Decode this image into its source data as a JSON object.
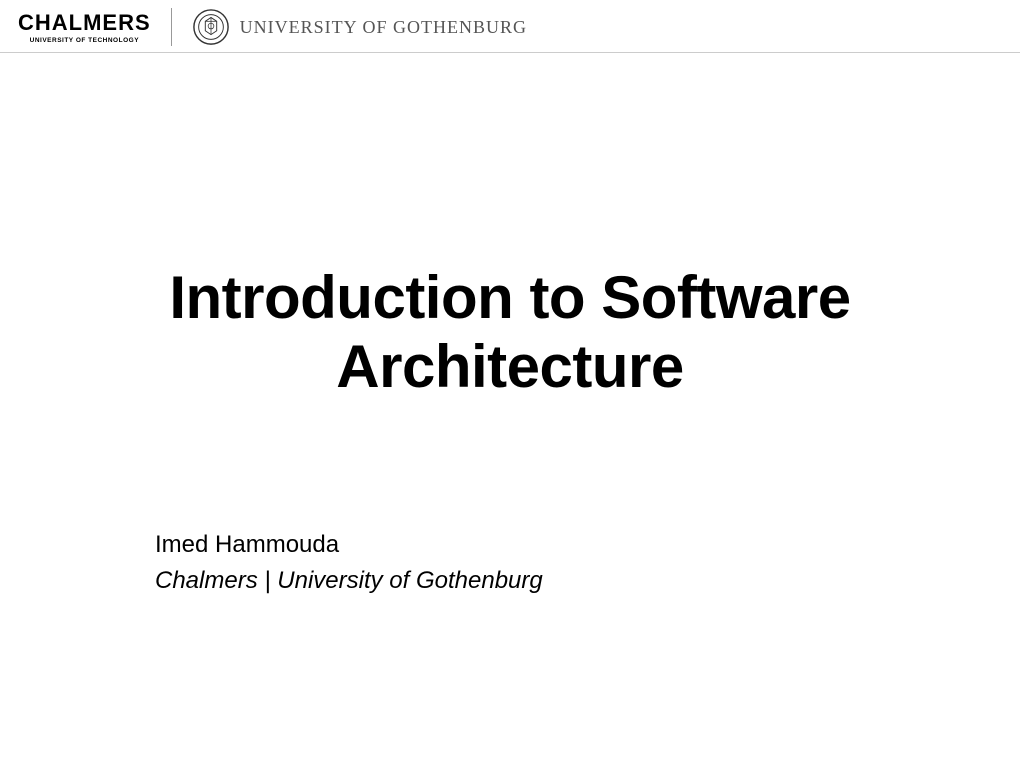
{
  "header": {
    "chalmers_main": "CHALMERS",
    "chalmers_sub": "UNIVERSITY OF TECHNOLOGY",
    "gu_text": "UNIVERSITY OF GOTHENBURG"
  },
  "title": "Introduction to Software Architecture",
  "author": {
    "name": "Imed Hammouda",
    "affiliation": "Chalmers | University of Gothenburg"
  }
}
